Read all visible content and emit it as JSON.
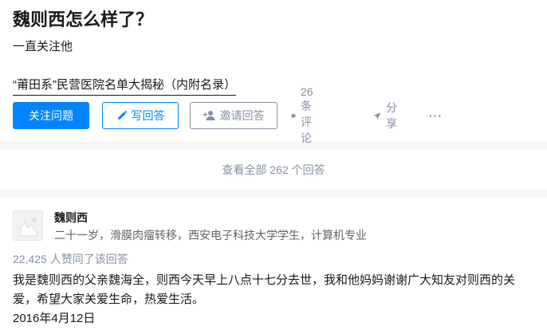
{
  "question": {
    "title": "魏则西怎么样了？",
    "detail": "一直关注他",
    "link_text": "“莆田系”民营医院名单大揭秘（内附名录）"
  },
  "actions": {
    "follow_label": "关注问题",
    "write_label": "写回答",
    "invite_label": "邀请回答",
    "comments_label": "26 条评论",
    "share_label": "分享",
    "more_label": "···"
  },
  "answers_summary": {
    "view_all_label": "查看全部 262 个回答"
  },
  "answer": {
    "author_name": "魏则西",
    "author_bio": "二十一岁，滑膜肉瘤转移，西安电子科技大学学生，计算机专业",
    "votes_text": "22,425 人赞同了该回答",
    "content": "我是魏则西的父亲魏海全，则西今天早上八点十七分去世，我和他妈妈谢谢广大知友对则西的关爱，希望大家关爱生命，热爱生活。",
    "date": "2016年4月12日"
  },
  "icons": {
    "write": "pen-icon",
    "invite": "add-user-icon",
    "comment": "comment-bubble-icon",
    "share": "paper-plane-icon",
    "more": "more-dots-icon",
    "avatar": "default-avatar-icon"
  },
  "colors": {
    "brand_blue": "#0084ff",
    "muted_gray": "#8590a6",
    "text": "#1a1a1a",
    "background": "#f6f6f6"
  }
}
